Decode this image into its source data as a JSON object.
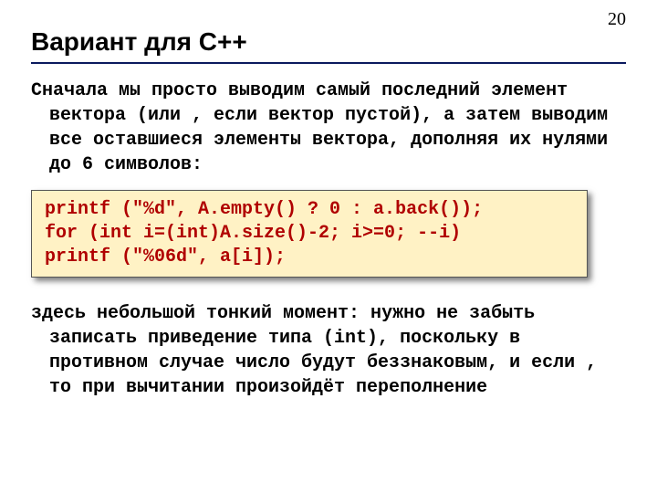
{
  "page_number": "20",
  "title": "Вариант для C++",
  "paragraph1": "Сначала мы просто выводим самый последний элемент вектора (или  , если вектор пустой), а затем выводим все оставшиеся элементы вектора, дополняя их нулями до 6 символов:",
  "code": "printf (\"%d\", A.empty() ? 0 : a.back());\nfor (int i=(int)A.size()-2; i>=0; --i)\nprintf (\"%06d\", a[i]);",
  "paragraph2": "здесь небольшой тонкий момент: нужно не забыть записать приведение типа  (int), поскольку в противном случае число   будут беззнаковым, и если  , то при вычитании произойдёт переполнение"
}
